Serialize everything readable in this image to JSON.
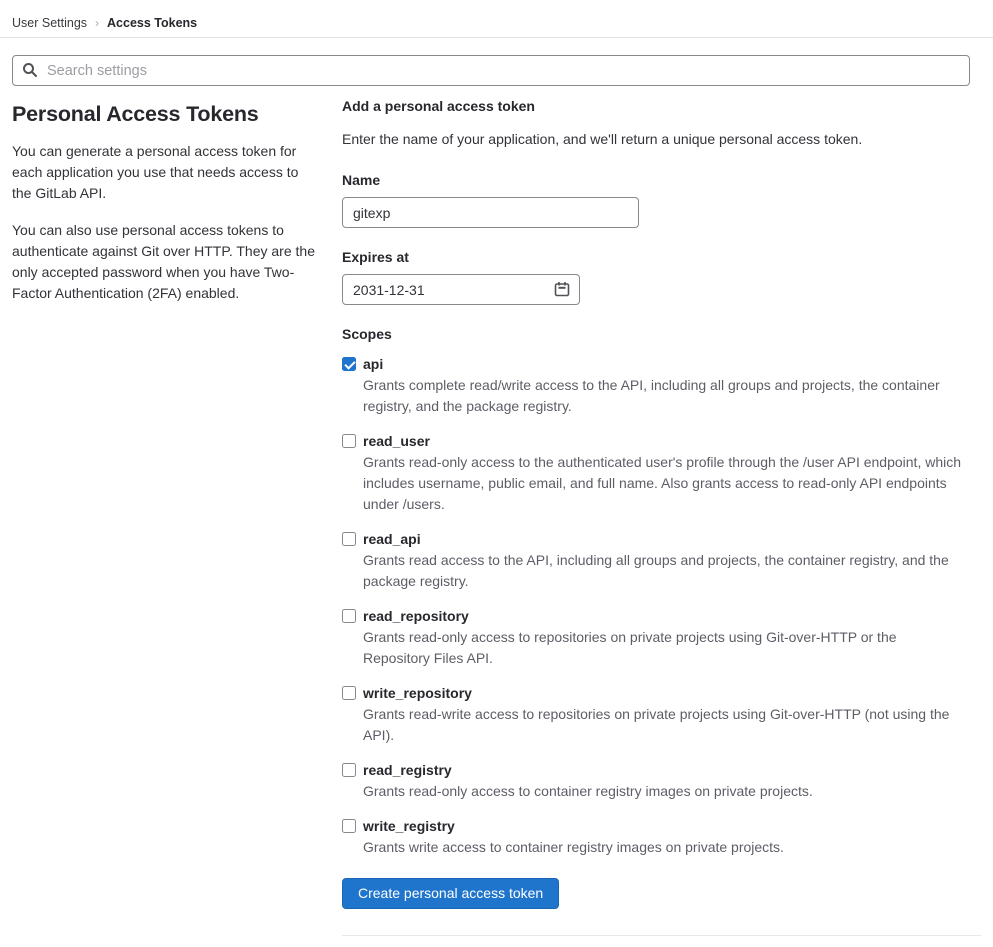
{
  "breadcrumb": {
    "parent": "User Settings",
    "separator": "›",
    "current": "Access Tokens"
  },
  "search": {
    "placeholder": "Search settings"
  },
  "sidebar": {
    "title": "Personal Access Tokens",
    "paragraph1": "You can generate a personal access token for each application you use that needs access to the GitLab API.",
    "paragraph2": "You can also use personal access tokens to authenticate against Git over HTTP. They are the only accepted password when you have Two-Factor Authentication (2FA) enabled."
  },
  "form": {
    "heading": "Add a personal access token",
    "description": "Enter the name of your application, and we'll return a unique personal access token.",
    "name_label": "Name",
    "name_value": "gitexp",
    "expires_label": "Expires at",
    "expires_value": "2031-12-31",
    "scopes_label": "Scopes",
    "scopes": [
      {
        "name": "api",
        "checked": true,
        "description": "Grants complete read/write access to the API, including all groups and projects, the container registry, and the package registry."
      },
      {
        "name": "read_user",
        "checked": false,
        "description": "Grants read-only access to the authenticated user's profile through the /user API endpoint, which includes username, public email, and full name. Also grants access to read-only API endpoints under /users."
      },
      {
        "name": "read_api",
        "checked": false,
        "description": "Grants read access to the API, including all groups and projects, the container registry, and the package registry."
      },
      {
        "name": "read_repository",
        "checked": false,
        "description": "Grants read-only access to repositories on private projects using Git-over-HTTP or the Repository Files API."
      },
      {
        "name": "write_repository",
        "checked": false,
        "description": "Grants read-write access to repositories on private projects using Git-over-HTTP (not using the API)."
      },
      {
        "name": "read_registry",
        "checked": false,
        "description": "Grants read-only access to container registry images on private projects."
      },
      {
        "name": "write_registry",
        "checked": false,
        "description": "Grants write access to container registry images on private projects."
      }
    ],
    "submit_label": "Create personal access token"
  },
  "colors": {
    "accent_blue": "#1f75cb",
    "checkbox_checked": "#1f75cb",
    "border_gray": "#89888d",
    "secondary_text": "#5e5d66"
  }
}
